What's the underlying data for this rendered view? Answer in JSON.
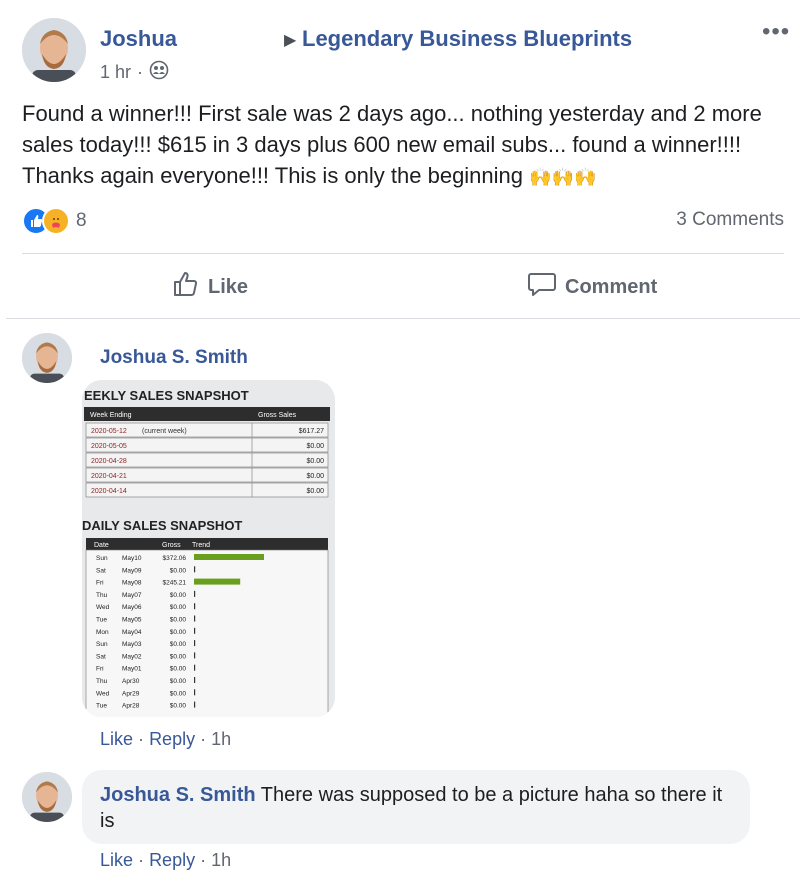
{
  "post": {
    "author": "Joshua",
    "group": "Legendary Business Blueprints",
    "time": "1 hr",
    "meta_separator": "·",
    "text": "Found a winner!!! First sale was 2 days ago... nothing yesterday and 2 more sales today!!! $615 in 3 days plus 600 new email subs... found a winner!!!! Thanks again everyone!!! This is only the beginning",
    "emoji": "🙌🙌🙌",
    "reaction_count": "8",
    "comments_count": "3 Comments",
    "more_icon": "more-options-icon"
  },
  "actions": {
    "like_label": "Like",
    "comment_label": "Comment"
  },
  "comments": [
    {
      "author": "Joshua S. Smith",
      "like": "Like",
      "reply": "Reply",
      "separator": "·",
      "time": "1h"
    },
    {
      "author": "Joshua S. Smith",
      "text": "There was supposed to be a picture haha so there it is",
      "like": "Like",
      "reply": "Reply",
      "separator": "·",
      "time": "1h"
    }
  ],
  "snapshot": {
    "weekly_title": "EEKLY SALES SNAPSHOT",
    "weekly_headers": [
      "Week Ending",
      "Gross Sales"
    ],
    "weekly_rows": [
      {
        "date": "2020-05-12",
        "note": "(current week)",
        "value": "$617.27"
      },
      {
        "date": "2020-05-05",
        "note": "",
        "value": "$0.00"
      },
      {
        "date": "2020-04-28",
        "note": "",
        "value": "$0.00"
      },
      {
        "date": "2020-04-21",
        "note": "",
        "value": "$0.00"
      },
      {
        "date": "2020-04-14",
        "note": "",
        "value": "$0.00"
      }
    ],
    "daily_title": "DAILY SALES SNAPSHOT",
    "daily_headers": [
      "Date",
      "Gross",
      "Trend"
    ],
    "daily_rows": [
      {
        "day": "Sun",
        "date": "May10",
        "gross": "$372.06",
        "trend": 1.0
      },
      {
        "day": "Sat",
        "date": "May09",
        "gross": "$0.00",
        "trend": 0
      },
      {
        "day": "Fri",
        "date": "May08",
        "gross": "$245.21",
        "trend": 0.66
      },
      {
        "day": "Thu",
        "date": "May07",
        "gross": "$0.00",
        "trend": 0
      },
      {
        "day": "Wed",
        "date": "May06",
        "gross": "$0.00",
        "trend": 0
      },
      {
        "day": "Tue",
        "date": "May05",
        "gross": "$0.00",
        "trend": 0
      },
      {
        "day": "Mon",
        "date": "May04",
        "gross": "$0.00",
        "trend": 0
      },
      {
        "day": "Sun",
        "date": "May03",
        "gross": "$0.00",
        "trend": 0
      },
      {
        "day": "Sat",
        "date": "May02",
        "gross": "$0.00",
        "trend": 0
      },
      {
        "day": "Fri",
        "date": "May01",
        "gross": "$0.00",
        "trend": 0
      },
      {
        "day": "Thu",
        "date": "Apr30",
        "gross": "$0.00",
        "trend": 0
      },
      {
        "day": "Wed",
        "date": "Apr29",
        "gross": "$0.00",
        "trend": 0
      },
      {
        "day": "Tue",
        "date": "Apr28",
        "gross": "$0.00",
        "trend": 0
      }
    ]
  },
  "colors": {
    "link": "#385898",
    "muted": "#606770",
    "like_blue": "#1877f2",
    "care_yellow": "#f7b125",
    "bar_green": "#6a9e1f"
  }
}
